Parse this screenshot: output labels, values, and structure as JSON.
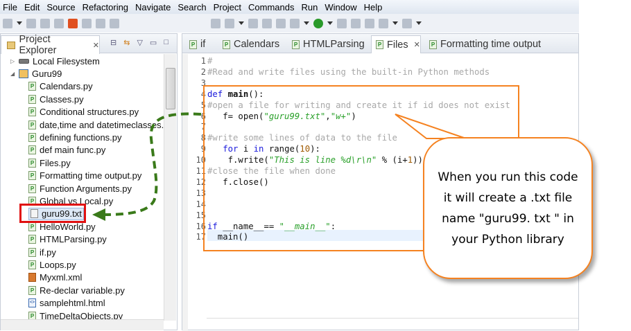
{
  "menu": [
    "File",
    "Edit",
    "Source",
    "Refactoring",
    "Navigate",
    "Search",
    "Project",
    "Commands",
    "Run",
    "Window",
    "Help"
  ],
  "explorer": {
    "title": "Project Explorer",
    "items": [
      {
        "label": "Local Filesystem",
        "level": 0,
        "icon": "drive-icon",
        "expander": "collapsed"
      },
      {
        "label": "Guru99",
        "level": 0,
        "icon": "project-icon",
        "expander": "expanded"
      },
      {
        "label": "Calendars.py",
        "level": 1,
        "icon": "python-file-icon"
      },
      {
        "label": "Classes.py",
        "level": 1,
        "icon": "python-file-icon"
      },
      {
        "label": "Conditional structures.py",
        "level": 1,
        "icon": "python-file-icon"
      },
      {
        "label": "date,time and datetimeclasses.py",
        "level": 1,
        "icon": "python-file-icon"
      },
      {
        "label": "defining functions.py",
        "level": 1,
        "icon": "python-file-icon"
      },
      {
        "label": "def main func.py",
        "level": 1,
        "icon": "python-file-icon"
      },
      {
        "label": "Files.py",
        "level": 1,
        "icon": "python-file-icon"
      },
      {
        "label": "Formatting time output.py",
        "level": 1,
        "icon": "python-file-warning-icon"
      },
      {
        "label": "Function Arguments.py",
        "level": 1,
        "icon": "python-file-icon"
      },
      {
        "label": "Global vs Local.py",
        "level": 1,
        "icon": "python-file-icon"
      },
      {
        "label": "guru99.txt",
        "level": 1,
        "icon": "text-file-icon",
        "selected": true
      },
      {
        "label": "HelloWorld.py",
        "level": 1,
        "icon": "python-file-icon"
      },
      {
        "label": "HTMLParsing.py",
        "level": 1,
        "icon": "python-file-icon"
      },
      {
        "label": "if.py",
        "level": 1,
        "icon": "python-file-icon"
      },
      {
        "label": "Loops.py",
        "level": 1,
        "icon": "python-file-icon"
      },
      {
        "label": "Myxml.xml",
        "level": 1,
        "icon": "xml-file-icon"
      },
      {
        "label": "Re-declar variable.py",
        "level": 1,
        "icon": "python-file-icon"
      },
      {
        "label": "samplehtml.html",
        "level": 1,
        "icon": "html-file-icon"
      },
      {
        "label": "TimeDeltaObjects.py",
        "level": 1,
        "icon": "python-file-icon"
      }
    ]
  },
  "editor": {
    "tabs": [
      {
        "label": "if"
      },
      {
        "label": "Calendars"
      },
      {
        "label": "HTMLParsing"
      },
      {
        "label": "Files",
        "active": true
      },
      {
        "label": "Formatting time output"
      }
    ],
    "lines": [
      [
        {
          "t": "#",
          "c": "cm"
        }
      ],
      [
        {
          "t": "#Read and write files using the built-in Python methods",
          "c": "cm"
        }
      ],
      [],
      [
        {
          "t": "def ",
          "c": "kw"
        },
        {
          "t": "main",
          "c": "bd"
        },
        {
          "t": "():"
        }
      ],
      [
        {
          "t": "#open a file for writing and create it if id does not exist",
          "c": "cm"
        }
      ],
      [
        {
          "t": "   f= open("
        },
        {
          "t": "\"guru99.txt\"",
          "c": "st"
        },
        {
          "t": ","
        },
        {
          "t": "\"w+\"",
          "c": "st"
        },
        {
          "t": ")"
        }
      ],
      [],
      [
        {
          "t": "#write some lines of data to the file",
          "c": "cm"
        }
      ],
      [
        {
          "t": "   "
        },
        {
          "t": "for",
          "c": "kw"
        },
        {
          "t": " i "
        },
        {
          "t": "in",
          "c": "kw"
        },
        {
          "t": " range("
        },
        {
          "t": "10",
          "c": "nm"
        },
        {
          "t": "):"
        }
      ],
      [
        {
          "t": "    f.write("
        },
        {
          "t": "\"This is line %d\\r\\n\"",
          "c": "st"
        },
        {
          "t": " % (i+"
        },
        {
          "t": "1",
          "c": "nm"
        },
        {
          "t": "))"
        }
      ],
      [
        {
          "t": "#close the file when done",
          "c": "cm"
        }
      ],
      [
        {
          "t": "   f.close()"
        }
      ],
      [],
      [],
      [],
      [
        {
          "t": "if",
          "c": "kw"
        },
        {
          "t": " __name__== "
        },
        {
          "t": "\"__main__\"",
          "c": "st"
        },
        {
          "t": ":"
        }
      ],
      [
        {
          "t": "  main()"
        }
      ]
    ]
  },
  "annotation": {
    "callout_text": "When you run this code it will create a .txt file name \"guru99. txt \" in your Python library",
    "accent": "#f58220",
    "arrow_color": "#3a7a1a",
    "highlight_color": "#e01010"
  }
}
